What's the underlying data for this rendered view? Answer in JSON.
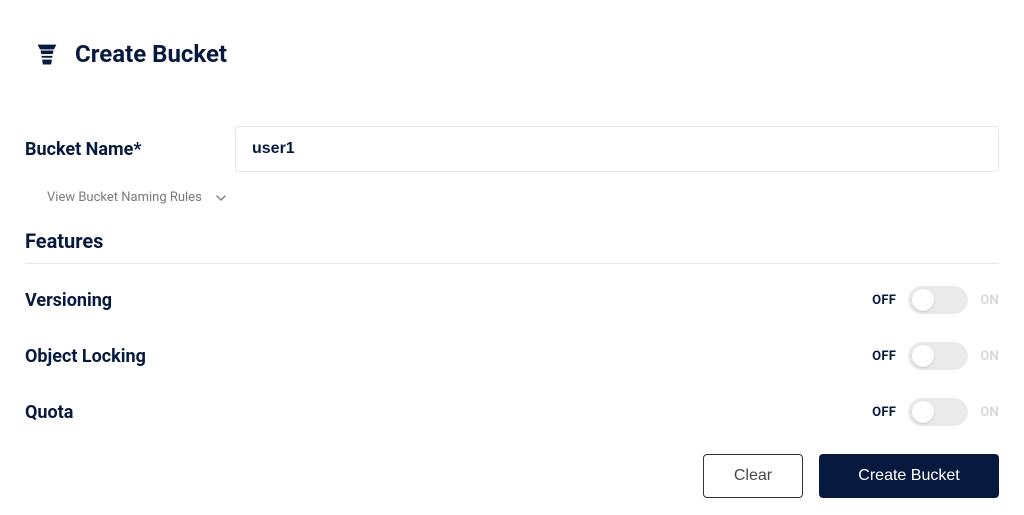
{
  "header": {
    "title": "Create Bucket"
  },
  "form": {
    "bucket_name_label": "Bucket Name*",
    "bucket_name_value": "user1",
    "naming_rules_label": "View Bucket Naming Rules"
  },
  "features": {
    "section_title": "Features",
    "items": [
      {
        "label": "Versioning",
        "off": "OFF",
        "on": "ON"
      },
      {
        "label": "Object Locking",
        "off": "OFF",
        "on": "ON"
      },
      {
        "label": "Quota",
        "off": "OFF",
        "on": "ON"
      }
    ]
  },
  "actions": {
    "clear_label": "Clear",
    "create_label": "Create Bucket"
  }
}
